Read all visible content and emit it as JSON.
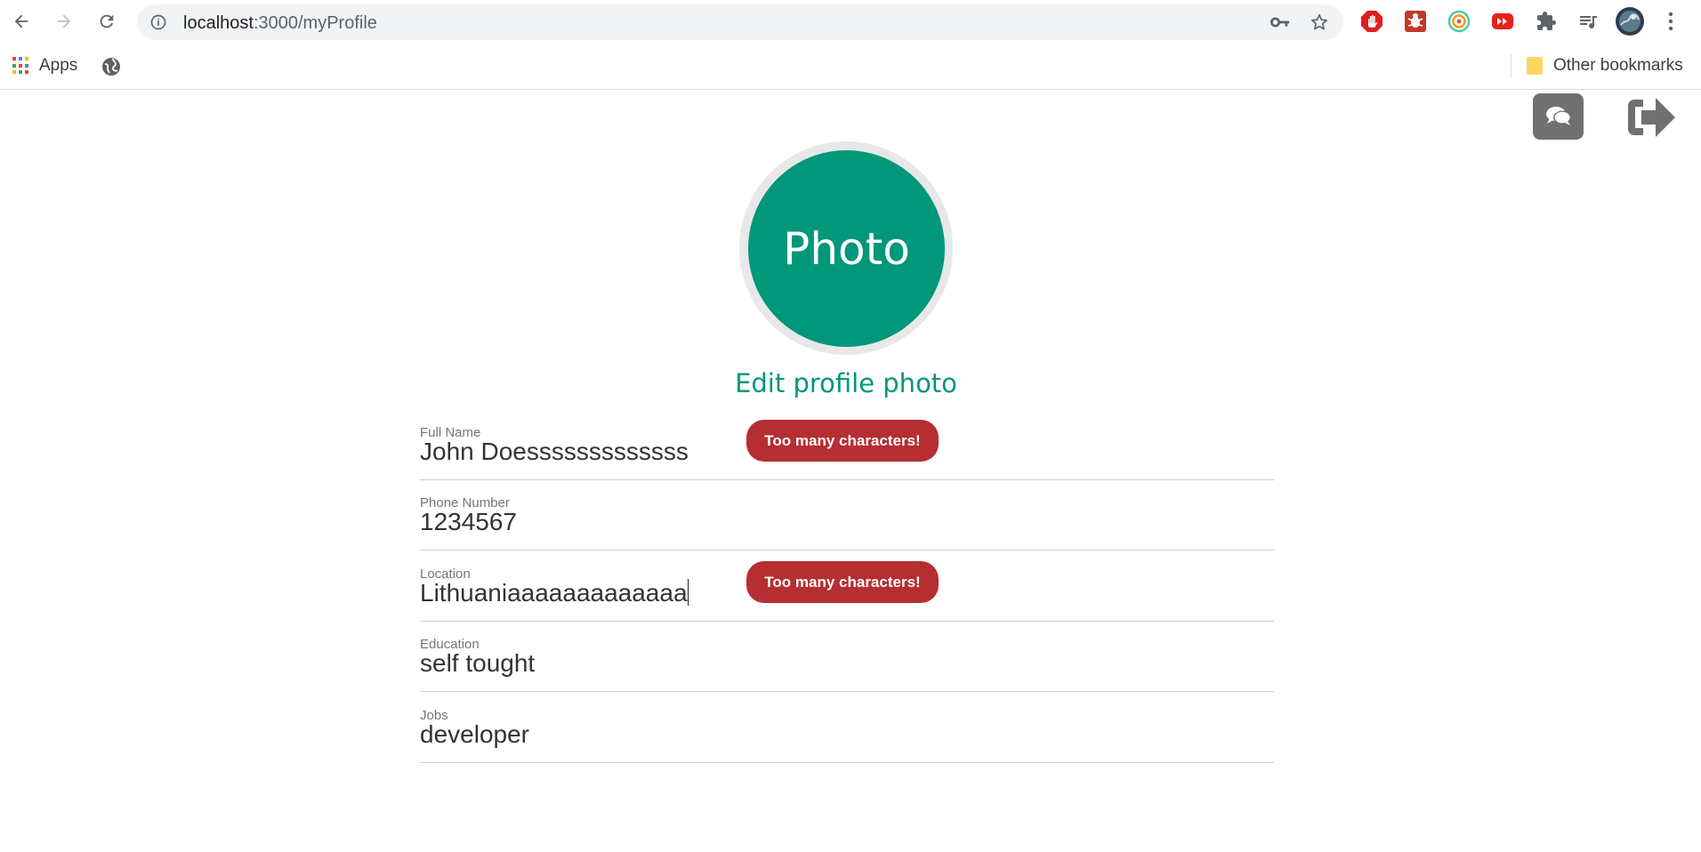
{
  "browser": {
    "url_host": "localhost",
    "url_path": ":3000/myProfile",
    "bookmarks": {
      "apps_label": "Apps",
      "other_label": "Other bookmarks"
    }
  },
  "profile": {
    "photo_text": "Photo",
    "edit_photo_label": "Edit profile photo",
    "warning_text": "Too many characters!",
    "fields": [
      {
        "label": "Full Name",
        "value": "John Doesssssssssssss",
        "error": "Too many characters!"
      },
      {
        "label": "Phone Number",
        "value": "1234567"
      },
      {
        "label": "Location",
        "value": "Lithuaniaaaaaaaaaaaaa",
        "error": "Too many characters!"
      },
      {
        "label": "Education",
        "value": "self tought"
      },
      {
        "label": "Jobs",
        "value": "developer"
      }
    ]
  },
  "colors": {
    "accent": "#00977a",
    "error": "#b52e31",
    "icon_button": "#707070"
  }
}
